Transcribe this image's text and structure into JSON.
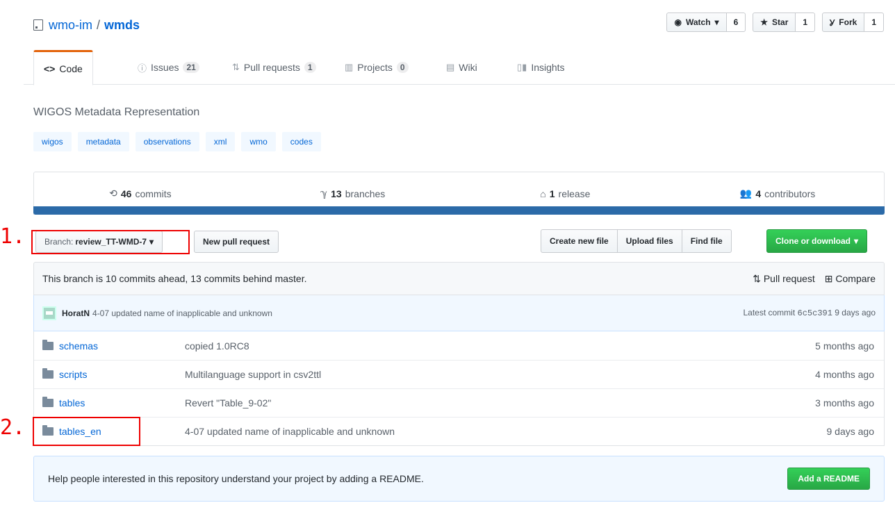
{
  "repo": {
    "owner": "wmo-im",
    "separator": "/",
    "name": "wmds"
  },
  "actions": {
    "watch": {
      "label": "Watch",
      "count": "6"
    },
    "star": {
      "label": "Star",
      "count": "1"
    },
    "fork": {
      "label": "Fork",
      "count": "1"
    }
  },
  "tabs": [
    {
      "label": "Code",
      "icon": "<>"
    },
    {
      "label": "Issues",
      "counter": "21"
    },
    {
      "label": "Pull requests",
      "counter": "1"
    },
    {
      "label": "Projects",
      "counter": "0"
    },
    {
      "label": "Wiki"
    },
    {
      "label": "Insights"
    }
  ],
  "description": "WIGOS Metadata Representation",
  "topics": [
    "wigos",
    "metadata",
    "observations",
    "xml",
    "wmo",
    "codes"
  ],
  "summary": {
    "commits": {
      "count": "46",
      "label": "commits"
    },
    "branches": {
      "count": "13",
      "label": "branches"
    },
    "releases": {
      "count": "1",
      "label": "release"
    },
    "contributors": {
      "count": "4",
      "label": "contributors"
    }
  },
  "branch": {
    "prefix": "Branch:",
    "name": "review_TT-WMD-7"
  },
  "buttons": {
    "new_pr": "New pull request",
    "create_file": "Create new file",
    "upload": "Upload files",
    "find": "Find file",
    "clone": "Clone or download"
  },
  "ahead_behind": "This branch is 10 commits ahead, 13 commits behind master.",
  "links": {
    "pull_request": "Pull request",
    "compare": "Compare"
  },
  "latest_commit": {
    "author": "HoratN",
    "message": "4-07 updated name of inapplicable and unknown",
    "prefix": "Latest commit",
    "sha": "6c5c391",
    "age": "9 days ago"
  },
  "files": [
    {
      "name": "schemas",
      "message": "copied 1.0RC8",
      "age": "5 months ago"
    },
    {
      "name": "scripts",
      "message": "Multilanguage support in csv2ttl",
      "age": "4 months ago"
    },
    {
      "name": "tables",
      "message": "Revert \"Table_9-02\"",
      "age": "3 months ago"
    },
    {
      "name": "tables_en",
      "message": "4-07 updated name of inapplicable and unknown",
      "age": "9 days ago"
    }
  ],
  "markers": {
    "first": "1.",
    "second": "2."
  },
  "readme": {
    "text": "Help people interested in this repository understand your project by adding a README.",
    "button": "Add a README"
  },
  "colors": {
    "accent": "#0366d6",
    "green": "#28a745",
    "highlight": "#ee0000",
    "tab_active": "#e36209",
    "lang_bar": "#2b6aa8"
  },
  "icons": [
    "repo-icon",
    "eye-icon",
    "star-icon",
    "fork-icon",
    "code-icon",
    "issue-icon",
    "pull-request-icon",
    "project-icon",
    "wiki-icon",
    "graph-icon",
    "history-icon",
    "branch-icon",
    "tag-icon",
    "people-icon",
    "folder-icon",
    "diff-icon",
    "caret-down-icon"
  ]
}
